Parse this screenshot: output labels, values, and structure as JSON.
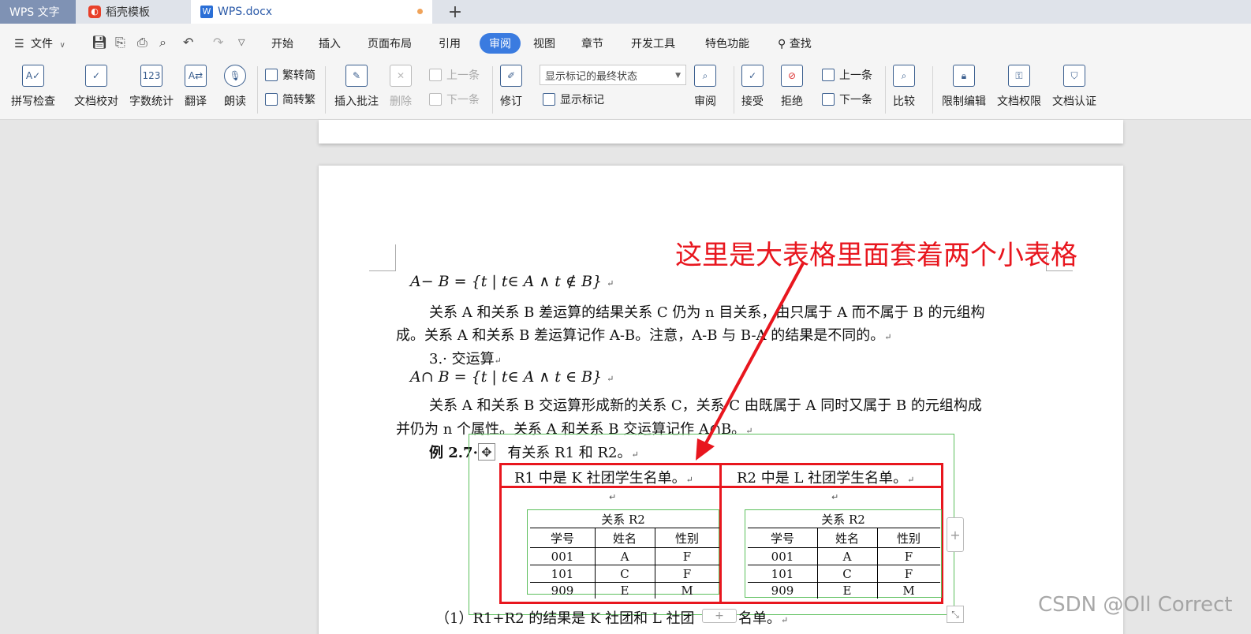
{
  "tabs": {
    "wps": "WPS 文字",
    "daoke": "稻壳模板",
    "doc": "WPS.docx",
    "plus": "+"
  },
  "menu": {
    "file": "文件",
    "items": [
      "开始",
      "插入",
      "页面布局",
      "引用",
      "审阅",
      "视图",
      "章节",
      "开发工具",
      "特色功能"
    ],
    "search": "查找",
    "active": "审阅"
  },
  "ribbon": {
    "spell": "拼写检查",
    "proof": "文档校对",
    "wordcount": "字数统计",
    "translate": "翻译",
    "read": "朗读",
    "trad_to_simp": "繁转简",
    "simp_to_trad": "简转繁",
    "insert_comment": "插入批注",
    "delete": "删除",
    "prev": "上一条",
    "next": "下一条",
    "revise": "修订",
    "markup_select": "显示标记的最终状态",
    "show_markup": "显示标记",
    "review": "审阅",
    "accept": "接受",
    "reject": "拒绝",
    "prev2": "上一条",
    "next2": "下一条",
    "compare": "比较",
    "restrict": "限制编辑",
    "permission": "文档权限",
    "certify": "文档认证",
    "icon_123": "123"
  },
  "document": {
    "formula_diff": "A− B = {t | t∈ A ∧ t ∉ B}",
    "para1_line1": "关系 A 和关系 B 差运算的结果关系 C 仍为 n 目关系，由只属于 A 而不属于 B 的元组构",
    "para1_line2": "成。关系 A 和关系 B 差运算记作 A-B。注意，A-B 与 B-A 的结果是不同的。",
    "heading3": "3.· 交运算",
    "formula_intersect": "A∩ B = {t | t∈ A ∧ t ∈ B}",
    "para2_line1": "关系 A 和关系 B 交运算形成新的关系 C，关系 C 由既属于 A 同时又属于 B 的元组构成",
    "para2_line2": "并仍为 n 个属性。关系 A 和关系 B 交运算记作 A∩B。",
    "example_label": "例 2.7·",
    "example_text": "有关系 R1 和 R2。",
    "item1": "（1）R1+R2 的结果是 K 社团和 L 社团",
    "item1_tail": "名单。",
    "para_mark": "↵"
  },
  "big_table": {
    "header_left": "R1 中是 K 社团学生名单。",
    "header_right": "R2 中是 L 社团学生名单。"
  },
  "inner_tables": [
    {
      "caption": "关系 R2",
      "columns": [
        "学号",
        "姓名",
        "性别"
      ],
      "rows": [
        [
          "001",
          "A",
          "F"
        ],
        [
          "101",
          "C",
          "F"
        ],
        [
          "909",
          "E",
          "M"
        ]
      ]
    },
    {
      "caption": "关系 R2",
      "columns": [
        "学号",
        "姓名",
        "性别"
      ],
      "rows": [
        [
          "001",
          "A",
          "F"
        ],
        [
          "101",
          "C",
          "F"
        ],
        [
          "909",
          "E",
          "M"
        ]
      ]
    }
  ],
  "annotation": "这里是大表格里面套着两个小表格",
  "watermark": "CSDN @Oll Correct",
  "colors": {
    "accent": "#3a7be0",
    "annotation": "#e8161e",
    "table_border": "#5cbf5c"
  }
}
